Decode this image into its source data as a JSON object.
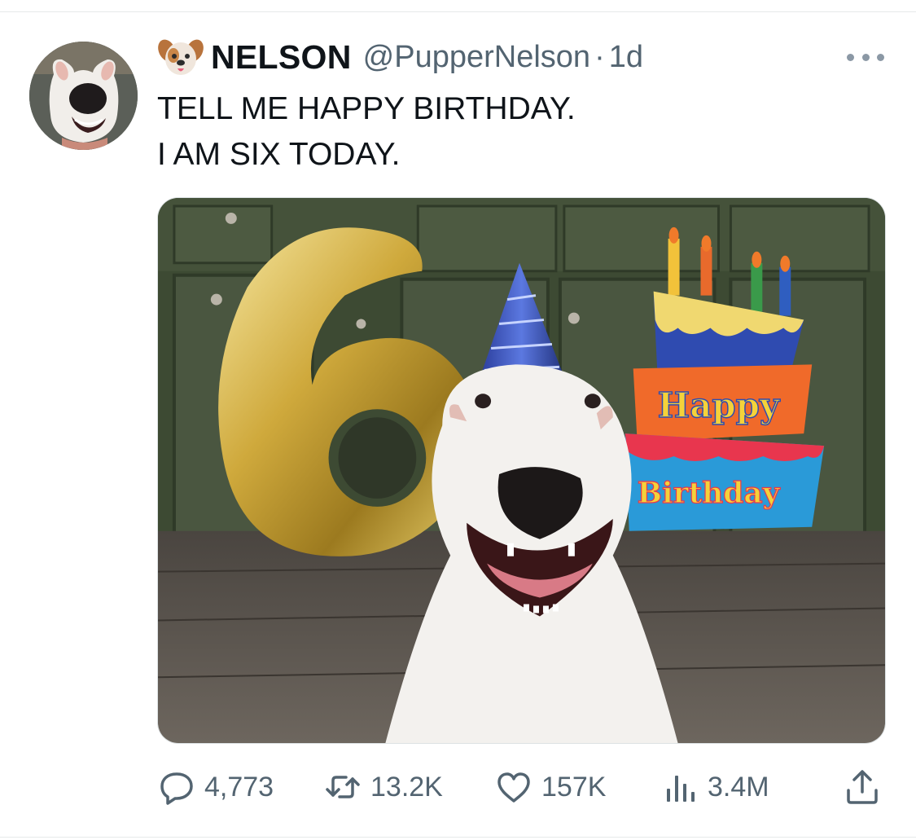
{
  "tweet": {
    "author": {
      "display_name": "NELSON",
      "emoji_icon": "dog-face-emoji",
      "handle": "@PupperNelson",
      "separator": "·",
      "time": "1d"
    },
    "text_lines": [
      "TELL ME HAPPY BIRTHDAY.",
      "I AM SIX TODAY."
    ],
    "photo": {
      "balloon_text": "6",
      "cake_text_top": "Happy",
      "cake_text_bottom": "Birthday"
    },
    "actions": {
      "reply": {
        "icon": "reply-bubble-icon",
        "count": "4,773"
      },
      "retweet": {
        "icon": "retweet-arrows-icon",
        "count": "13.2K"
      },
      "like": {
        "icon": "heart-icon",
        "count": "157K"
      },
      "views": {
        "icon": "bar-chart-icon",
        "count": "3.4M"
      },
      "share": {
        "icon": "share-upload-icon"
      }
    },
    "more_icon": "ellipsis-icon"
  },
  "colors": {
    "text": "#0f1419",
    "secondary": "#536471",
    "divider": "#e6e9ea"
  }
}
